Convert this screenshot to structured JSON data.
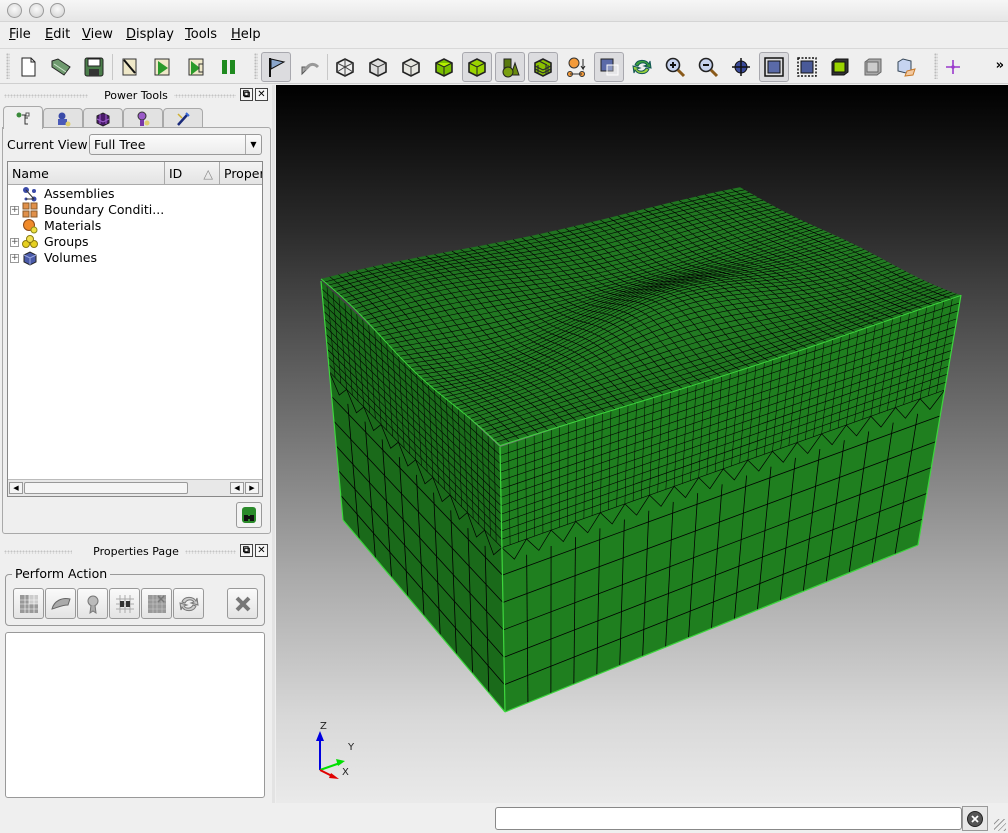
{
  "window": {
    "controls": [
      "close",
      "minimize",
      "maximize"
    ]
  },
  "menubar": {
    "items": [
      {
        "label": "File",
        "mnemonic": "F",
        "rest": "ile"
      },
      {
        "label": "Edit",
        "mnemonic": "E",
        "rest": "dit"
      },
      {
        "label": "View",
        "mnemonic": "V",
        "rest": "iew"
      },
      {
        "label": "Display",
        "mnemonic": "D",
        "rest": "isplay"
      },
      {
        "label": "Tools",
        "mnemonic": "T",
        "rest": "ools"
      },
      {
        "label": "Help",
        "mnemonic": "H",
        "rest": "elp"
      }
    ]
  },
  "toolbar": {
    "buttons": [
      {
        "name": "new-file",
        "icon": "new-file-icon",
        "active": false
      },
      {
        "name": "open-file",
        "icon": "open-folder-icon",
        "active": false
      },
      {
        "name": "save-file",
        "icon": "save-disk-icon",
        "active": false
      },
      {
        "name": "edit-journal",
        "icon": "script-edit-icon",
        "active": false
      },
      {
        "name": "play-journal",
        "icon": "script-play-icon",
        "active": false
      },
      {
        "name": "step-journal",
        "icon": "script-step-icon",
        "active": false
      },
      {
        "name": "pause-journal",
        "icon": "pause-icon",
        "active": false
      },
      {
        "name": "select-mode",
        "icon": "flag-pointer-icon",
        "active": true
      },
      {
        "name": "undo",
        "icon": "undo-arrow-icon",
        "active": false
      },
      {
        "name": "wireframe",
        "icon": "wireframe-cube-icon",
        "active": false
      },
      {
        "name": "hidden-line",
        "icon": "hiddenline-cube-icon",
        "active": false
      },
      {
        "name": "transparent",
        "icon": "transparent-cube-icon",
        "active": false
      },
      {
        "name": "smooth-shade",
        "icon": "shaded-cube-icon",
        "active": false
      },
      {
        "name": "show-volumes",
        "icon": "volume-cube-icon",
        "active": true
      },
      {
        "name": "show-geometry",
        "icon": "geometry-shapes-icon",
        "active": true
      },
      {
        "name": "show-mesh",
        "icon": "mesh-cube-icon",
        "active": true
      },
      {
        "name": "node-display",
        "icon": "nodes-icon",
        "active": false
      },
      {
        "name": "parallel-projection",
        "icon": "projection-icon",
        "active": true
      },
      {
        "name": "refresh",
        "icon": "refresh-icon",
        "active": false
      },
      {
        "name": "zoom-in",
        "icon": "zoom-in-icon",
        "active": false
      },
      {
        "name": "zoom-out",
        "icon": "zoom-out-icon",
        "active": false
      },
      {
        "name": "center-view",
        "icon": "crosshair-globe-icon",
        "active": false
      },
      {
        "name": "fit-view",
        "icon": "frame-icon",
        "active": true
      },
      {
        "name": "zoom-region",
        "icon": "film-frame-icon",
        "active": false
      },
      {
        "name": "view-front",
        "icon": "view-cube-icon",
        "active": false
      },
      {
        "name": "view-top",
        "icon": "view-cube-gray-icon",
        "active": false
      },
      {
        "name": "view-iso",
        "icon": "view-iso-icon",
        "active": false
      },
      {
        "name": "origin-marker",
        "icon": "crosshair-icon",
        "active": false
      }
    ],
    "overflow_label": "»"
  },
  "power_tools": {
    "title": "Power Tools",
    "tabs": [
      {
        "name": "model-tree",
        "icon": "tree-icon",
        "active": true
      },
      {
        "name": "geometry-tools",
        "icon": "geometry-tab-icon",
        "active": false
      },
      {
        "name": "mesh-tools",
        "icon": "mesh-tab-icon",
        "active": false
      },
      {
        "name": "quality-tools",
        "icon": "quality-tab-icon",
        "active": false
      },
      {
        "name": "cleanup-tools",
        "icon": "wand-tab-icon",
        "active": false
      }
    ],
    "current_view_label": "Current View",
    "current_view_value": "Full Tree",
    "columns": [
      "Name",
      "ID",
      "Proper"
    ],
    "sort_indicator": "△",
    "tree": [
      {
        "label": "Assemblies",
        "icon": "assemblies-icon",
        "expandable": false
      },
      {
        "label": "Boundary Conditi...",
        "icon": "boundary-conditions-icon",
        "expandable": true
      },
      {
        "label": "Materials",
        "icon": "materials-icon",
        "expandable": false
      },
      {
        "label": "Groups",
        "icon": "groups-icon",
        "expandable": true
      },
      {
        "label": "Volumes",
        "icon": "volumes-icon",
        "expandable": true
      }
    ]
  },
  "properties_page": {
    "title": "Properties Page",
    "group_title": "Perform Action",
    "actions": [
      {
        "name": "mesh-action",
        "icon": "mesh-grid-icon"
      },
      {
        "name": "smooth-action",
        "icon": "iron-icon"
      },
      {
        "name": "quality-action",
        "icon": "ribbon-icon"
      },
      {
        "name": "find-action",
        "icon": "binocular-grid-icon"
      },
      {
        "name": "delete-mesh-action",
        "icon": "grid-x-icon"
      },
      {
        "name": "refresh-action",
        "icon": "refresh-icon"
      }
    ],
    "close_action": {
      "name": "close-action",
      "icon": "x-icon"
    }
  },
  "viewport": {
    "model_color": "#1f7f1f",
    "edge_color": "#000000",
    "highlight_color": "#3dd63d",
    "triad": {
      "x_label": "X",
      "y_label": "Y",
      "z_label": "Z",
      "x_color": "#e00000",
      "y_color": "#00e000",
      "z_color": "#0000e0"
    }
  },
  "command_line": {
    "value": "",
    "placeholder": ""
  }
}
